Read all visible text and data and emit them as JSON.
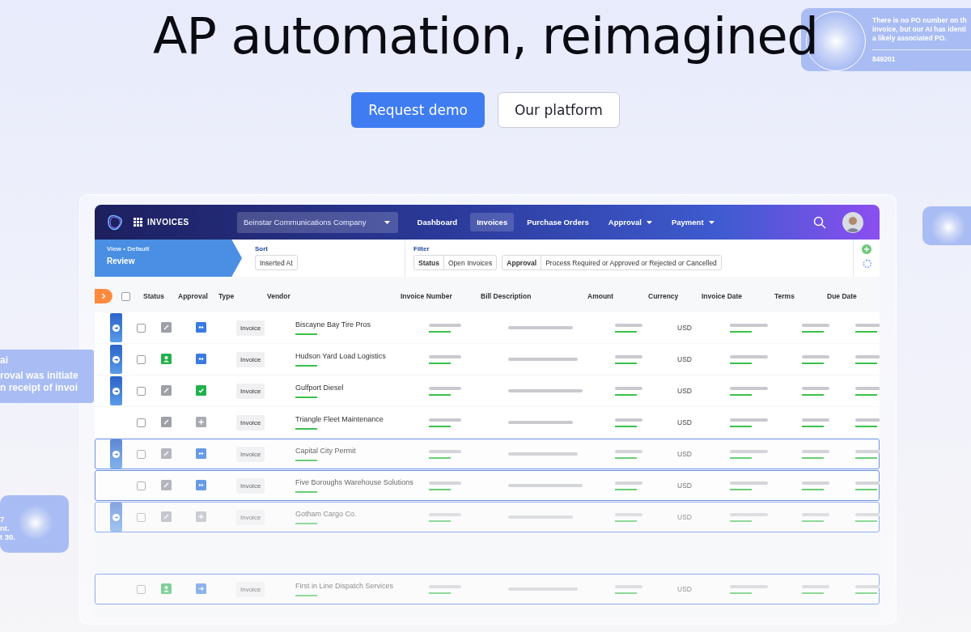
{
  "hero": {
    "title": "AP automation, reimagined",
    "buttons": [
      {
        "label": "Request demo",
        "kind": "primary"
      },
      {
        "label": "Our platform",
        "kind": "secondary"
      }
    ]
  },
  "floating_cards": [
    {
      "kind": "top-right",
      "lines": [
        "There is no PO number on th",
        "invoice, but our AI has identi",
        "a likely associated PO."
      ],
      "footer": "849201"
    },
    {
      "kind": "left",
      "lines": [
        "ai",
        "roval was initiate",
        "n receipt of invoi"
      ]
    },
    {
      "kind": "bottom-left",
      "lines": [
        "7",
        "nt.",
        "t 30."
      ]
    },
    {
      "kind": "right-glow"
    }
  ],
  "app": {
    "module": "INVOICES",
    "company": "Beinstar Communications Company",
    "nav": [
      {
        "label": "Dashboard",
        "selected": false,
        "dropdown": false
      },
      {
        "label": "Invoices",
        "selected": true,
        "dropdown": false
      },
      {
        "label": "Purchase Orders",
        "selected": false,
        "dropdown": false
      },
      {
        "label": "Approval",
        "selected": false,
        "dropdown": true
      },
      {
        "label": "Payment",
        "selected": false,
        "dropdown": true
      }
    ],
    "view": {
      "caption": "View • Default",
      "name": "Review"
    },
    "sort": {
      "label": "Sort",
      "value": "Inserted At"
    },
    "filter": {
      "label": "Filter",
      "chips": [
        {
          "key": "Status",
          "value": "Open Invoices"
        },
        {
          "key": "Approval",
          "value": "Process Required or Approved or Rejected or Cancelled"
        }
      ]
    },
    "select_all": {
      "checked": false
    },
    "columns": [
      "Status",
      "Approval",
      "Type",
      "Vendor",
      "Invoice Number",
      "Bill Description",
      "Amount",
      "Currency",
      "Invoice Date",
      "Terms",
      "Due Date"
    ],
    "rows": [
      {
        "flagged": true,
        "outlined": false,
        "kind": "solid",
        "status": {
          "kind": "edit"
        },
        "approval": {
          "kind": "dots"
        },
        "type": "Invoice",
        "vendor": "Biscayne Bay Tire Pros",
        "currency": "USD"
      },
      {
        "flagged": true,
        "outlined": false,
        "kind": "solid",
        "status": {
          "kind": "person"
        },
        "approval": {
          "kind": "dots"
        },
        "type": "Invoice",
        "vendor": "Hudson Yard Load Logistics",
        "currency": "USD"
      },
      {
        "flagged": true,
        "outlined": false,
        "kind": "solid",
        "status": {
          "kind": "edit"
        },
        "approval": {
          "kind": "check"
        },
        "type": "Invoice",
        "vendor": "Gulfport Diesel",
        "currency": "USD"
      },
      {
        "flagged": false,
        "outlined": false,
        "kind": "solid",
        "status": {
          "kind": "edit"
        },
        "approval": {
          "kind": "plus"
        },
        "type": "Invoice",
        "vendor": "Triangle Fleet Maintenance",
        "currency": "USD"
      },
      {
        "flagged": true,
        "outlined": true,
        "kind": "faded",
        "status": {
          "kind": "edit"
        },
        "approval": {
          "kind": "dots"
        },
        "type": "Invoice",
        "vendor": "Capital City Permit",
        "currency": "USD"
      },
      {
        "flagged": false,
        "outlined": true,
        "kind": "faded",
        "status": {
          "kind": "edit"
        },
        "approval": {
          "kind": "dots"
        },
        "type": "Invoice",
        "vendor": "Five Boroughs Warehouse Solutions",
        "currency": "USD"
      },
      {
        "flagged": true,
        "outlined": true,
        "kind": "ghost",
        "status": {
          "kind": "edit"
        },
        "approval": {
          "kind": "plus"
        },
        "type": "Invoice",
        "vendor": "Gotham Cargo Co.",
        "currency": "USD"
      },
      {
        "flagged": false,
        "outlined": true,
        "kind": "ghost",
        "status": {
          "kind": "person"
        },
        "approval": {
          "kind": "arrow"
        },
        "type": "Invoice",
        "vendor": "First in Line Dispatch Services",
        "currency": "USD"
      }
    ]
  }
}
